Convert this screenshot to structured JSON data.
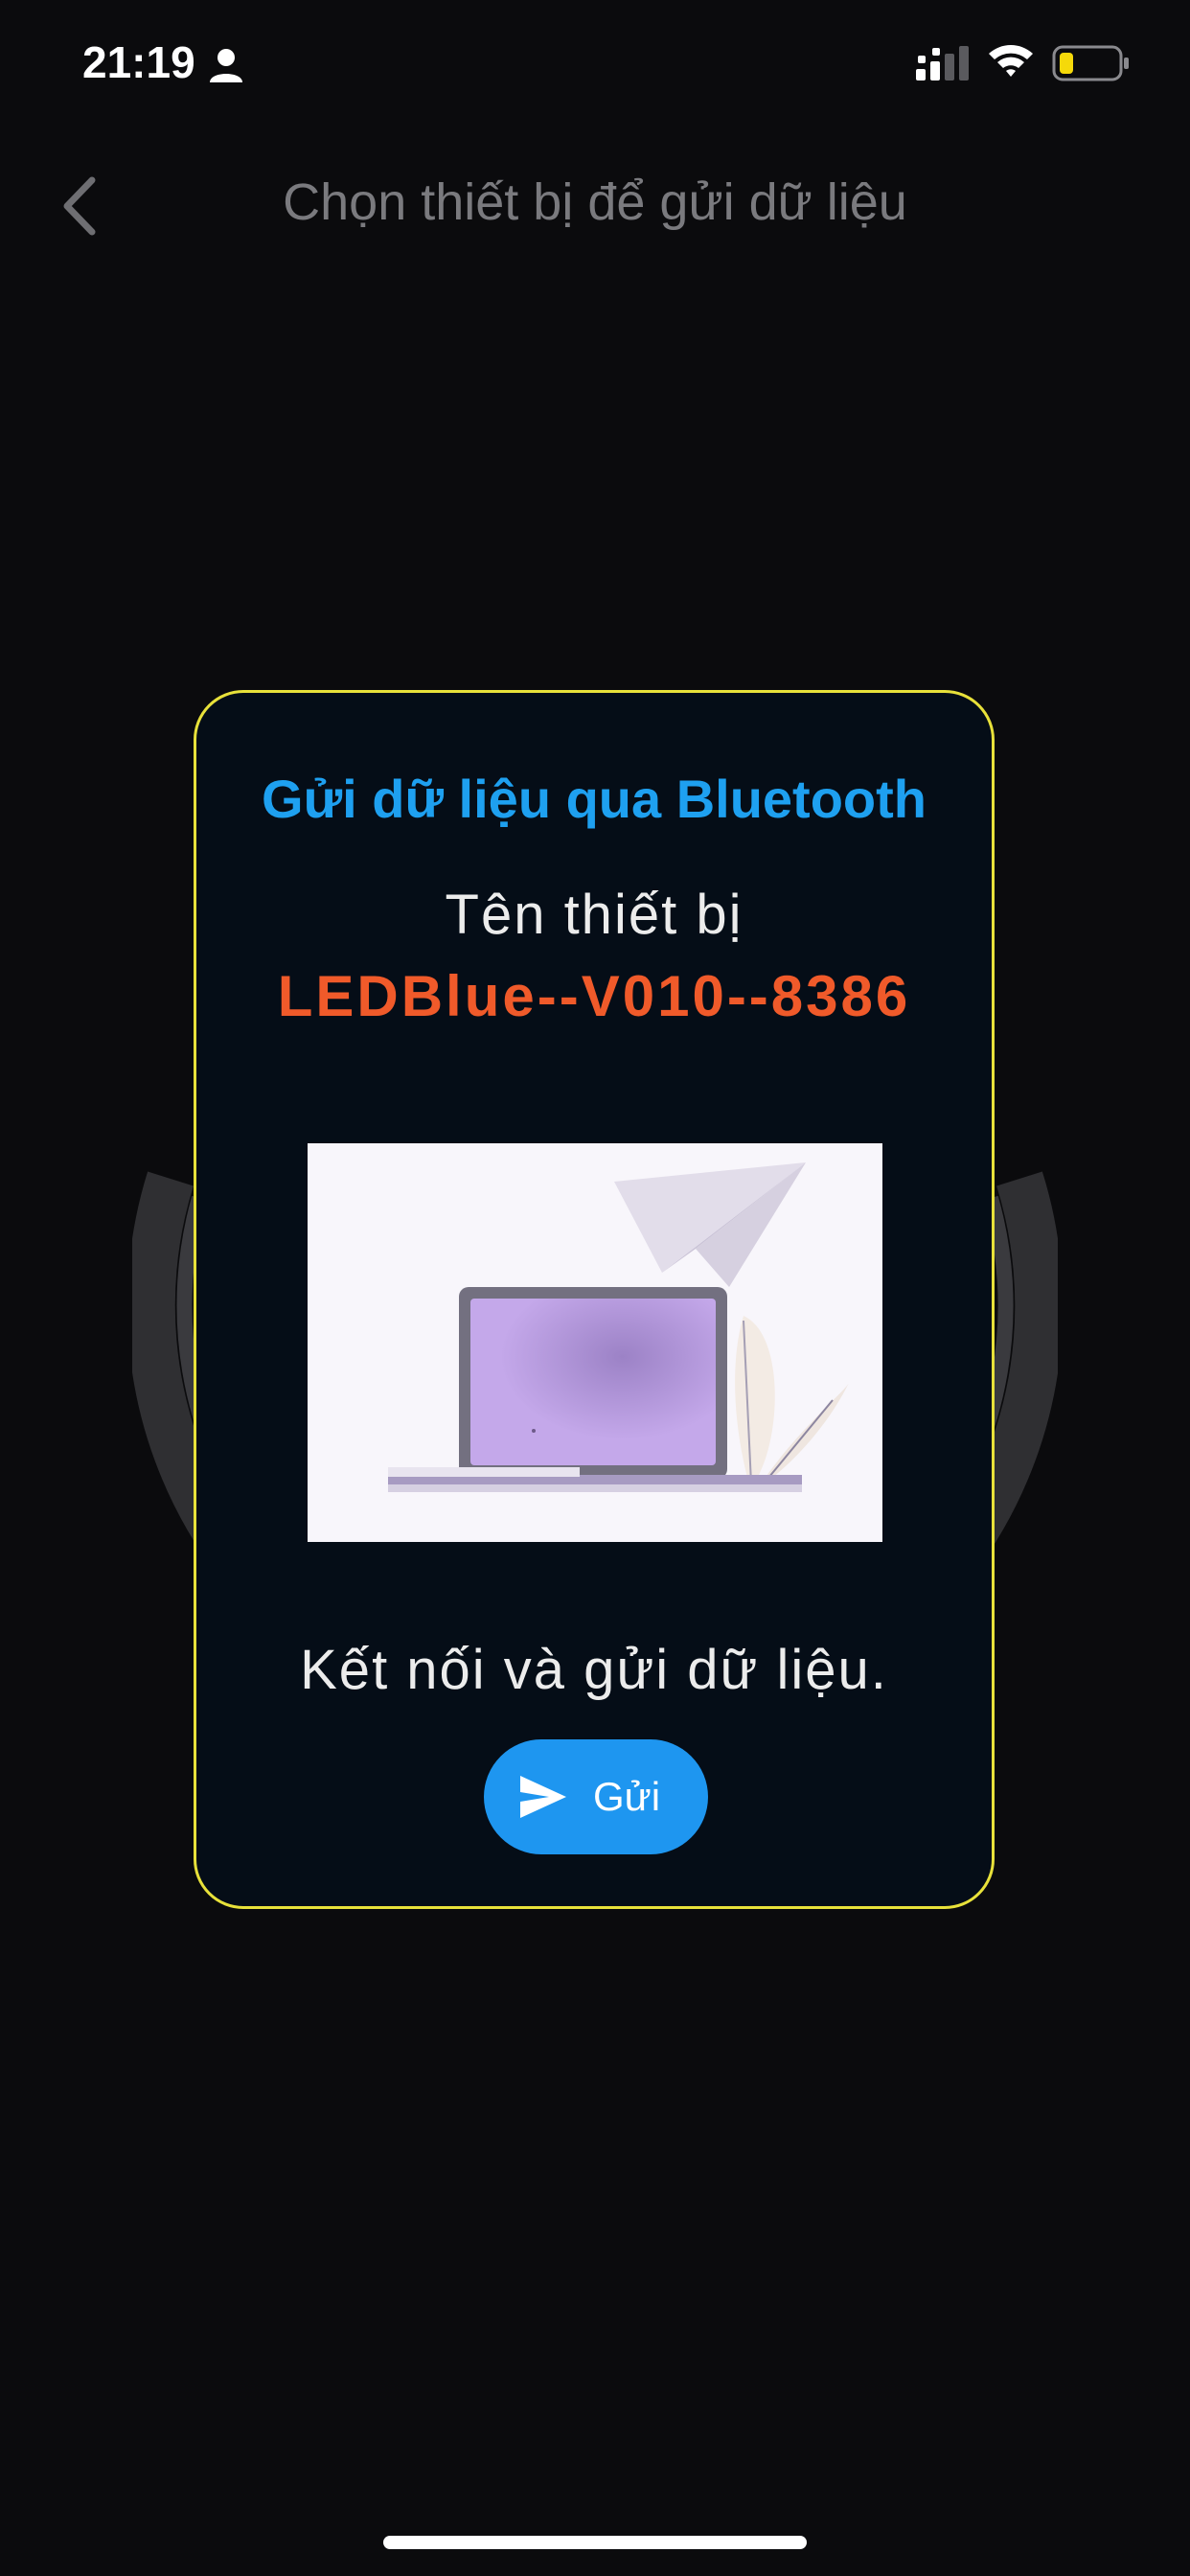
{
  "status_bar": {
    "time": "21:19",
    "icons": [
      "person-icon",
      "cellular-signal-icon",
      "wifi-icon",
      "battery-icon"
    ],
    "battery_color": "#f5d90a"
  },
  "header": {
    "back_icon": "chevron-left-icon",
    "title": "Chọn thiết bị để gửi dữ liệu"
  },
  "modal": {
    "title": "Gửi dữ liệu qua Bluetooth",
    "device_label": "Tên thiết bị",
    "device_name": "LEDBlue--V010--8386",
    "illustration": "laptop-paper-plane-illustration",
    "message": "Kết nối và gửi dữ liệu.",
    "send_button": {
      "icon": "send-icon",
      "label": "Gửi"
    },
    "border_color": "#e8e13a"
  },
  "colors": {
    "accent_blue": "#1ea0f0",
    "device_name_orange": "#f05a2a",
    "button_blue": "#1e96f0",
    "background": "#0b0b0d"
  }
}
